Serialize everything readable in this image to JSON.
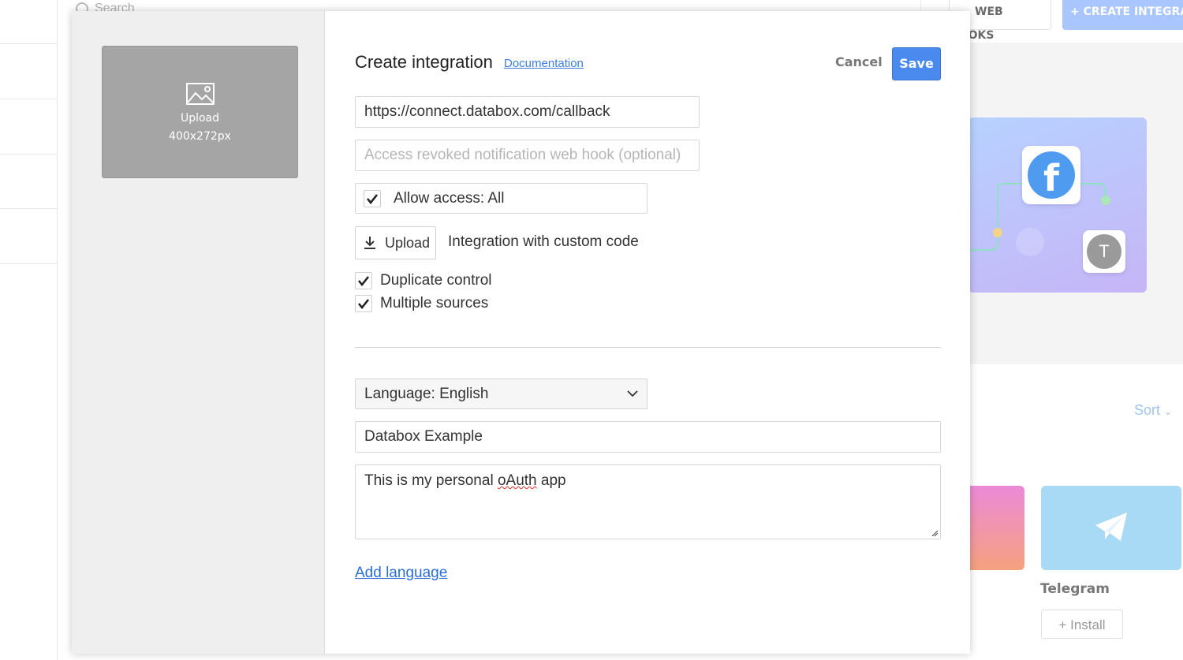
{
  "background": {
    "search_placeholder": "Search",
    "webhooks_label": "WEB HOOKS",
    "create_integration_label": "+ CREATE INTEGRATION",
    "hero_badge_letter": "T",
    "sort_label": "Sort",
    "telegram_name": "Telegram",
    "install_label": "+ Install"
  },
  "modal": {
    "image_upload": {
      "label": "Upload",
      "size": "400x272px"
    },
    "title": "Create integration",
    "documentation_link": "Documentation",
    "cancel_label": "Cancel",
    "save_label": "Save",
    "callback_url": "https://connect.databox.com/callback",
    "revoked_webhook_placeholder": "Access revoked notification web hook (optional)",
    "allow_access": {
      "label": "Allow access: All",
      "checked": true
    },
    "upload_code_label": "Upload",
    "custom_code_text": "Integration with custom code",
    "options": [
      {
        "label": "Duplicate control",
        "checked": true
      },
      {
        "label": "Multiple sources",
        "checked": true
      }
    ],
    "language_select": "Language: English",
    "integration_name": "Databox Example",
    "description": {
      "before": "This is my personal ",
      "misspelled": "oAuth",
      "after": " app"
    },
    "add_language_link": "Add language"
  },
  "colors": {
    "primary": "#4a8aef",
    "link": "#3d7ee0",
    "modal_sidebar": "#efefef",
    "image_placeholder": "#a5a5a5"
  }
}
